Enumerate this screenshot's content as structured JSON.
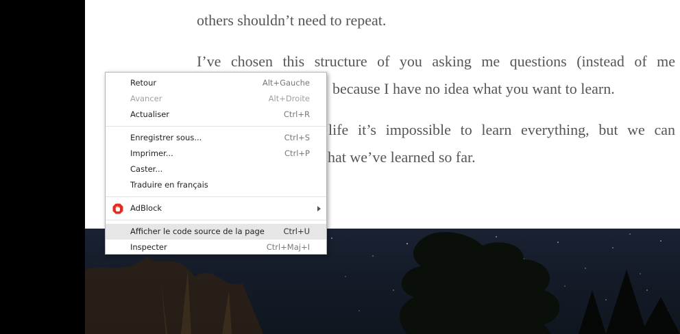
{
  "article": {
    "p1_line2": "others shouldn’t need to repeat.",
    "p2_line1": "I’ve chosen this structure of you asking me questions (instead of me",
    "p2_line2": "because I have no idea what you want to learn.",
    "p3_line1": "life it’s impossible to learn everything, but we can",
    "p3_line2": "hat we’ve learned so far."
  },
  "context_menu": {
    "groups": [
      [
        {
          "label": "Retour",
          "shortcut": "Alt+Gauche",
          "disabled": false
        },
        {
          "label": "Avancer",
          "shortcut": "Alt+Droite",
          "disabled": true
        },
        {
          "label": "Actualiser",
          "shortcut": "Ctrl+R",
          "disabled": false
        }
      ],
      [
        {
          "label": "Enregistrer sous...",
          "shortcut": "Ctrl+S",
          "disabled": false
        },
        {
          "label": "Imprimer...",
          "shortcut": "Ctrl+P",
          "disabled": false
        },
        {
          "label": "Caster...",
          "shortcut": "",
          "disabled": false
        },
        {
          "label": "Traduire en français",
          "shortcut": "",
          "disabled": false
        }
      ],
      [
        {
          "label": "AdBlock",
          "icon": "adblock-icon",
          "submenu": true
        }
      ],
      [
        {
          "label": "Afficher le code source de la page",
          "shortcut": "Ctrl+U",
          "highlighted": true
        },
        {
          "label": "Inspecter",
          "shortcut": "Ctrl+Maj+I",
          "disabled": false
        }
      ]
    ]
  },
  "colors": {
    "text": "#555555",
    "menu_highlight": "#e6e6e6",
    "adblock_red": "#e52b1e"
  }
}
